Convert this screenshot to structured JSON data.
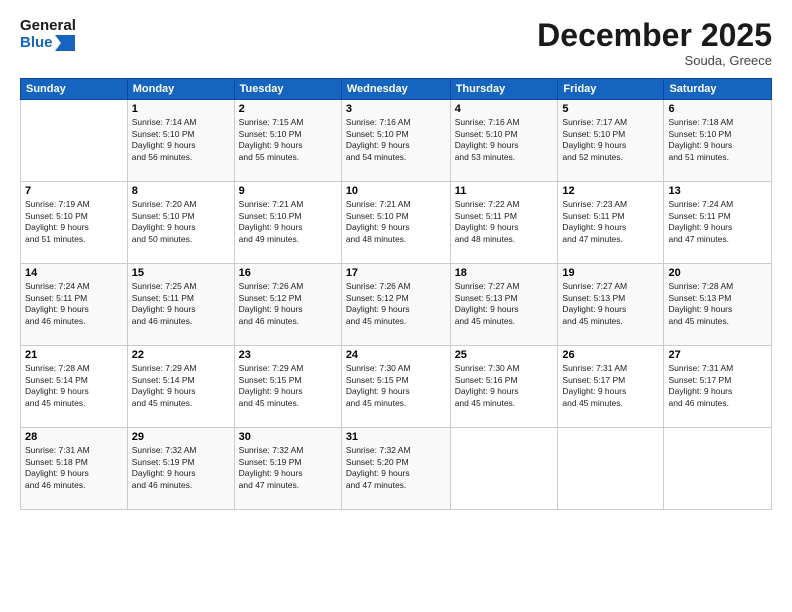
{
  "header": {
    "logo_line1": "General",
    "logo_line2": "Blue",
    "month": "December 2025",
    "location": "Souda, Greece"
  },
  "days_of_week": [
    "Sunday",
    "Monday",
    "Tuesday",
    "Wednesday",
    "Thursday",
    "Friday",
    "Saturday"
  ],
  "weeks": [
    [
      {
        "day": "",
        "info": ""
      },
      {
        "day": "1",
        "info": "Sunrise: 7:14 AM\nSunset: 5:10 PM\nDaylight: 9 hours\nand 56 minutes."
      },
      {
        "day": "2",
        "info": "Sunrise: 7:15 AM\nSunset: 5:10 PM\nDaylight: 9 hours\nand 55 minutes."
      },
      {
        "day": "3",
        "info": "Sunrise: 7:16 AM\nSunset: 5:10 PM\nDaylight: 9 hours\nand 54 minutes."
      },
      {
        "day": "4",
        "info": "Sunrise: 7:16 AM\nSunset: 5:10 PM\nDaylight: 9 hours\nand 53 minutes."
      },
      {
        "day": "5",
        "info": "Sunrise: 7:17 AM\nSunset: 5:10 PM\nDaylight: 9 hours\nand 52 minutes."
      },
      {
        "day": "6",
        "info": "Sunrise: 7:18 AM\nSunset: 5:10 PM\nDaylight: 9 hours\nand 51 minutes."
      }
    ],
    [
      {
        "day": "7",
        "info": "Sunrise: 7:19 AM\nSunset: 5:10 PM\nDaylight: 9 hours\nand 51 minutes."
      },
      {
        "day": "8",
        "info": "Sunrise: 7:20 AM\nSunset: 5:10 PM\nDaylight: 9 hours\nand 50 minutes."
      },
      {
        "day": "9",
        "info": "Sunrise: 7:21 AM\nSunset: 5:10 PM\nDaylight: 9 hours\nand 49 minutes."
      },
      {
        "day": "10",
        "info": "Sunrise: 7:21 AM\nSunset: 5:10 PM\nDaylight: 9 hours\nand 48 minutes."
      },
      {
        "day": "11",
        "info": "Sunrise: 7:22 AM\nSunset: 5:11 PM\nDaylight: 9 hours\nand 48 minutes."
      },
      {
        "day": "12",
        "info": "Sunrise: 7:23 AM\nSunset: 5:11 PM\nDaylight: 9 hours\nand 47 minutes."
      },
      {
        "day": "13",
        "info": "Sunrise: 7:24 AM\nSunset: 5:11 PM\nDaylight: 9 hours\nand 47 minutes."
      }
    ],
    [
      {
        "day": "14",
        "info": "Sunrise: 7:24 AM\nSunset: 5:11 PM\nDaylight: 9 hours\nand 46 minutes."
      },
      {
        "day": "15",
        "info": "Sunrise: 7:25 AM\nSunset: 5:11 PM\nDaylight: 9 hours\nand 46 minutes."
      },
      {
        "day": "16",
        "info": "Sunrise: 7:26 AM\nSunset: 5:12 PM\nDaylight: 9 hours\nand 46 minutes."
      },
      {
        "day": "17",
        "info": "Sunrise: 7:26 AM\nSunset: 5:12 PM\nDaylight: 9 hours\nand 45 minutes."
      },
      {
        "day": "18",
        "info": "Sunrise: 7:27 AM\nSunset: 5:13 PM\nDaylight: 9 hours\nand 45 minutes."
      },
      {
        "day": "19",
        "info": "Sunrise: 7:27 AM\nSunset: 5:13 PM\nDaylight: 9 hours\nand 45 minutes."
      },
      {
        "day": "20",
        "info": "Sunrise: 7:28 AM\nSunset: 5:13 PM\nDaylight: 9 hours\nand 45 minutes."
      }
    ],
    [
      {
        "day": "21",
        "info": "Sunrise: 7:28 AM\nSunset: 5:14 PM\nDaylight: 9 hours\nand 45 minutes."
      },
      {
        "day": "22",
        "info": "Sunrise: 7:29 AM\nSunset: 5:14 PM\nDaylight: 9 hours\nand 45 minutes."
      },
      {
        "day": "23",
        "info": "Sunrise: 7:29 AM\nSunset: 5:15 PM\nDaylight: 9 hours\nand 45 minutes."
      },
      {
        "day": "24",
        "info": "Sunrise: 7:30 AM\nSunset: 5:15 PM\nDaylight: 9 hours\nand 45 minutes."
      },
      {
        "day": "25",
        "info": "Sunrise: 7:30 AM\nSunset: 5:16 PM\nDaylight: 9 hours\nand 45 minutes."
      },
      {
        "day": "26",
        "info": "Sunrise: 7:31 AM\nSunset: 5:17 PM\nDaylight: 9 hours\nand 45 minutes."
      },
      {
        "day": "27",
        "info": "Sunrise: 7:31 AM\nSunset: 5:17 PM\nDaylight: 9 hours\nand 46 minutes."
      }
    ],
    [
      {
        "day": "28",
        "info": "Sunrise: 7:31 AM\nSunset: 5:18 PM\nDaylight: 9 hours\nand 46 minutes."
      },
      {
        "day": "29",
        "info": "Sunrise: 7:32 AM\nSunset: 5:19 PM\nDaylight: 9 hours\nand 46 minutes."
      },
      {
        "day": "30",
        "info": "Sunrise: 7:32 AM\nSunset: 5:19 PM\nDaylight: 9 hours\nand 47 minutes."
      },
      {
        "day": "31",
        "info": "Sunrise: 7:32 AM\nSunset: 5:20 PM\nDaylight: 9 hours\nand 47 minutes."
      },
      {
        "day": "",
        "info": ""
      },
      {
        "day": "",
        "info": ""
      },
      {
        "day": "",
        "info": ""
      }
    ]
  ]
}
